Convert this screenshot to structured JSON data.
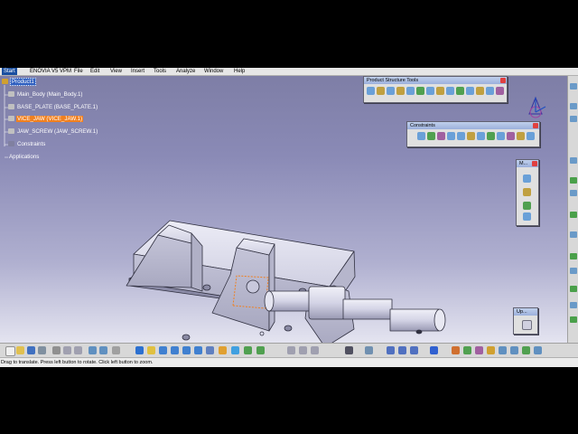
{
  "menu": {
    "items": [
      "Start",
      "ENOVIA V5 VPM",
      "File",
      "Edit",
      "View",
      "Insert",
      "Tools",
      "Analyze",
      "Window",
      "Help"
    ]
  },
  "tree": {
    "root": "Product1",
    "parts": [
      {
        "label": "Main_Body (Main_Body.1)",
        "state": "normal"
      },
      {
        "label": "BASE_PLATE (BASE_PLATE.1)",
        "state": "normal"
      },
      {
        "label": "VICE_JAW (VICE_JAW.1)",
        "state": "highlighted"
      },
      {
        "label": "JAW_SCREW (JAW_SCREW.1)",
        "state": "normal"
      }
    ],
    "constraints": "Constraints",
    "applications": "Applications"
  },
  "toolbars": {
    "product_structure": {
      "title": "Product Structure Tools"
    },
    "constraints": {
      "title": "Constraints"
    },
    "measure": {
      "title": "M..."
    },
    "update": {
      "title": "Up..."
    }
  },
  "status": {
    "message": "Drag to translate. Press left button to rotate. Click left button to zoom."
  },
  "colors": {
    "background_top": "#7e7ea6",
    "background_bottom": "#e4e4f0",
    "part_fill": "#d8d8ec",
    "selection_orange": "#f08020",
    "tree_select": "#3060c0"
  }
}
